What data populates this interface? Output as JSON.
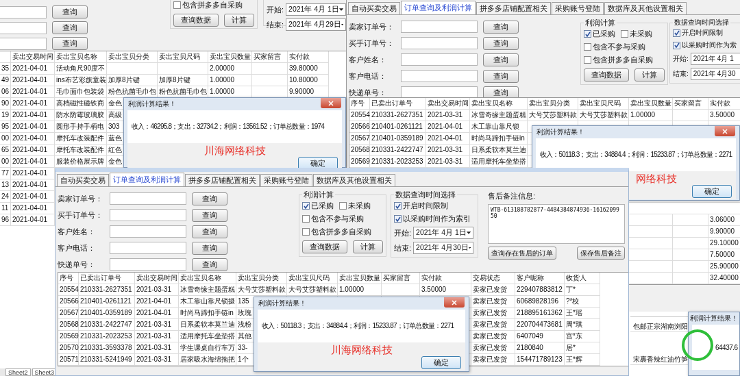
{
  "back_window": {
    "search_buttons": [
      "查询",
      "查询",
      "查询"
    ],
    "profit": {
      "options": [
        {
          "label": "包含拼多多自采购",
          "checked": false
        }
      ],
      "buttons": [
        "查询数据",
        "计算"
      ]
    },
    "dates": [
      {
        "label": "开始:",
        "value": "2021年 4月 1日"
      },
      {
        "label": "结束:",
        "value": "2021年 4月29日"
      }
    ],
    "table": {
      "columns": [
        null,
        "卖出交易时间",
        "卖出宝贝名称",
        "卖出宝贝分类",
        "卖出宝贝尺码",
        "卖出宝贝数量",
        "买家留言",
        "实付款"
      ],
      "rows": [
        [
          "35",
          "2021-04-01",
          "活动角尺90度不",
          null,
          null,
          "2.00000",
          null,
          "39.80000"
        ],
        [
          "49",
          "2021-04-01",
          "ins布艺彩旗童装",
          "加厚8片键",
          "加厚8片键",
          "1.00000",
          null,
          "10.80000"
        ],
        [
          "06",
          "2021-04-01",
          "毛巾面巾包装袋",
          "粉色抗菌毛巾包",
          "粉色抗菌毛巾包",
          "1.00000",
          null,
          "9.90000"
        ],
        [
          "90",
          "2021-04-01",
          "高档磁性磁铁商",
          "金色"
        ],
        [
          "19",
          "2021-04-01",
          "防水防霉玻璃胶",
          "高级"
        ],
        [
          "95",
          "2021-04-01",
          "圆形手持手柄电",
          "303"
        ],
        [
          "00",
          "2021-04-01",
          "摩托车改装配件",
          "蓝色"
        ],
        [
          "65",
          "2021-04-01",
          "摩托车改装配件",
          "红色"
        ],
        [
          "00",
          "2021-04-01",
          "服装价格展示牌",
          "金色"
        ],
        [
          "77",
          "2021-04-01"
        ],
        [
          "13",
          "2021-04-01"
        ],
        [
          "24",
          "2021-04-01"
        ],
        [
          "11",
          "2021-04-01"
        ],
        [
          "96",
          "2021-04-01"
        ]
      ]
    },
    "sheet_tabs": [
      "Sheet2",
      "Sheet3"
    ]
  },
  "order_window": {
    "tabs": [
      {
        "label": "自动买卖交易",
        "selected": false
      },
      {
        "label": "订单查询及利润计算",
        "selected": true
      },
      {
        "label": "拼多多店铺配置相关",
        "selected": false
      },
      {
        "label": "采购账号登陆",
        "selected": false
      },
      {
        "label": "数据库及其他设置相关",
        "selected": false
      }
    ],
    "form": [
      {
        "label": "卖家订单号：",
        "button": "查询"
      },
      {
        "label": "买手订单号：",
        "button": "查询"
      },
      {
        "label": "客户姓名：",
        "button": "查询"
      },
      {
        "label": "客户电话：",
        "button": "查询"
      },
      {
        "label": "快递单号：",
        "button": "查询"
      }
    ],
    "profit": {
      "title": "利润计算",
      "options": [
        {
          "label": "已采购",
          "checked": true
        },
        {
          "label": "未采购",
          "checked": false
        },
        {
          "label": "包含不参与采购",
          "checked": false
        },
        {
          "label": "包含拼多多自采购",
          "checked": false
        }
      ],
      "buttons": [
        "查询数据",
        "计算"
      ]
    },
    "time": {
      "title": "数据查询时间选择",
      "options": [
        {
          "label": "开启时间限制",
          "checked": true
        },
        {
          "label": "以采购时间作为索",
          "checked": true
        }
      ],
      "dates": [
        {
          "label": "开始:",
          "value": "2021年 4月 1"
        },
        {
          "label": "结束:",
          "value": "2021年 4月30"
        }
      ]
    },
    "table": {
      "columns": [
        "序号",
        "已卖出订单号",
        "卖出交易时间",
        "卖出宝贝名称",
        "卖出宝贝分类",
        "卖出宝贝尺码",
        "卖出宝贝数量",
        "买家留言",
        "实付款"
      ],
      "rows": [
        [
          "20554",
          "210331-2627351",
          "2021-03-31",
          "冰雪奇缘主题蛋糕",
          "大号艾莎塑料款",
          "大号艾莎塑料款",
          "1.00000",
          null,
          "3.50000"
        ],
        [
          "20566",
          "210401-0261121",
          "2021-04-01",
          "木工靠山靠尺锁"
        ],
        [
          "20567",
          "210401-0359189",
          "2021-04-01",
          "时尚马蹄扣手链in"
        ],
        [
          "20568",
          "210331-2422747",
          "2021-03-31",
          "日系柔软本莫兰迪"
        ],
        [
          "20569",
          "210331-2023253",
          "2021-03-31",
          "适用摩托车坐垫搭"
        ],
        [
          null,
          null,
          null,
          null,
          null,
          null,
          null,
          null,
          "3.06000"
        ],
        [
          null,
          null,
          null,
          null,
          null,
          null,
          null,
          null,
          "9.90000"
        ],
        [
          null,
          null,
          null,
          null,
          null,
          null,
          null,
          null,
          "29.10000"
        ],
        [
          null,
          null,
          null,
          null,
          null,
          null,
          null,
          null,
          "7.50000"
        ],
        [
          null,
          null,
          null,
          null,
          null,
          null,
          null,
          null,
          "25.90000"
        ],
        [
          null,
          null,
          null,
          null,
          null,
          null,
          null,
          null,
          "32.40000"
        ]
      ]
    }
  },
  "dialog_left": {
    "title": "利润计算结果！",
    "message": "收入：46295.8；支出：32734.2；利润：13561.52；订单总数量：1974",
    "brand": "川海网络科技",
    "button": "确定"
  },
  "dialog_right": {
    "title": "利润计算结果！",
    "message": "收入：50118.3；支出：34884.4；利润：15233.87；订单总数量：2271",
    "brand": "网络科技",
    "button": "确定"
  },
  "front_window": {
    "tabs": [
      {
        "label": "自动买卖交易",
        "selected": false
      },
      {
        "label": "订单查询及利润计算",
        "selected": true
      },
      {
        "label": "拼多多店铺配置相关",
        "selected": false
      },
      {
        "label": "采购账号登陆",
        "selected": false
      },
      {
        "label": "数据库及其他设置相关",
        "selected": false
      }
    ],
    "form": [
      {
        "label": "卖家订单号：",
        "button": "查询"
      },
      {
        "label": "买手订单号：",
        "button": "查询"
      },
      {
        "label": "客户姓名：",
        "button": "查询"
      },
      {
        "label": "客户电话：",
        "button": "查询"
      },
      {
        "label": "快递单号：",
        "button": "查询"
      }
    ],
    "profit": {
      "title": "利润计算",
      "options": [
        {
          "label": "已采购",
          "checked": true
        },
        {
          "label": "未采购",
          "checked": false
        },
        {
          "label": "包含不参与采购",
          "checked": false
        },
        {
          "label": "包含拼多多自采购",
          "checked": false
        }
      ],
      "buttons": [
        "查询数据",
        "计算"
      ]
    },
    "time": {
      "title": "数据查询时间选择",
      "options": [
        {
          "label": "开启时间限制",
          "checked": true
        },
        {
          "label": "以采购时间作为索引",
          "checked": true
        }
      ],
      "dates": [
        {
          "label": "开始:",
          "value": "2021年 4月 1日"
        },
        {
          "label": "结束:",
          "value": "2021年 4月30日"
        }
      ]
    },
    "aftersale": {
      "label": "售后备注信息:",
      "note": "WTB-613188782877-4484384874936-1616209950",
      "buttons": [
        "查询存在售后的订单",
        "保存售后备注"
      ]
    },
    "table": {
      "columns": [
        "序号",
        "已卖出订单号",
        "卖出交易时间",
        "卖出宝贝名称",
        "卖出宝贝分类",
        "卖出宝贝尺码",
        "卖出宝贝数量",
        "买家留言",
        "实付款",
        "交易状态",
        "客户昵称",
        "收货人"
      ],
      "rows": [
        [
          "20554",
          "210331-2627351",
          "2021-03-31",
          "冰雪奇缘主题蛋糕",
          "大号艾莎塑料款",
          "大号艾莎塑料款",
          "1.00000",
          null,
          "3.50000",
          "卖家已发货",
          "229407883812",
          "丁*"
        ],
        [
          "20566",
          "210401-0261121",
          "2021-04-01",
          "木工靠山靠尺锁摄",
          "135",
          null,
          null,
          null,
          null,
          "卖家已发货",
          "60689828196",
          "?*校"
        ],
        [
          "20567",
          "210401-0359189",
          "2021-04-01",
          "时尚马蹄扣手链in",
          "玫瑰",
          null,
          null,
          null,
          null,
          "卖家已发货",
          "218895161362",
          "王*瑶"
        ],
        [
          "20568",
          "210331-2422747",
          "2021-03-31",
          "日系柔软本莫兰迪",
          "浅粉",
          null,
          null,
          null,
          null,
          "卖家已发货",
          "220704473681",
          "周*琪"
        ],
        [
          "20569",
          "210331-2023253",
          "2021-03-31",
          "适用摩托车坐垫搭",
          "其他",
          null,
          null,
          null,
          null,
          "卖家已发货",
          "6407049",
          "宫*东"
        ],
        [
          "20570",
          "210331-3593378",
          "2021-03-31",
          "学生课桌自行车万",
          "33-",
          null,
          null,
          null,
          null,
          "卖家已发货",
          "2180840",
          "居*"
        ],
        [
          "20571",
          "210331-5241949",
          "2021-03-31",
          "居家吸水海绵拖把",
          "1个",
          null,
          null,
          null,
          null,
          "卖家已发货",
          "154471789123",
          "王*辉"
        ]
      ]
    }
  },
  "dialog_front": {
    "title": "利润计算结果！",
    "message": "收入：50118.3；支出：34884.4；利润：15233.87；订单总数量：2271",
    "brand": "川海网络科技",
    "button": "确定"
  },
  "corner_window": {
    "items": [
      "包邮正宗湖南浏阳",
      "宋裹香辣红油竹笋"
    ],
    "dialog": {
      "title": "利润计算结果！",
      "message": "64437.6"
    }
  }
}
